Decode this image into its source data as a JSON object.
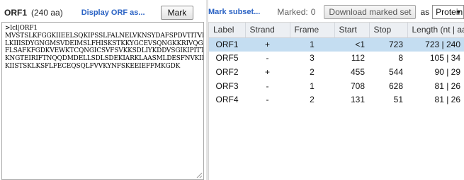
{
  "left_header": {
    "orf_title": "ORF1",
    "orf_length": "(240 aa)",
    "display_link": "Display ORF as...",
    "mark_button": "Mark"
  },
  "sequence": {
    "lines": [
      ">lcl|ORF1",
      "MVSTSLKFGGKIIEELSQKIPSSLFALNELVKNSYDAFSPDVTITVIPSE",
      "LKIIISDYGNGMSVDEIMSLFHISKSTKKYGCEVSQNGKKRIVQGSKGLG",
      "FLSAFKFGDKVEWKTCQNGICSVFSVKKSDLIYKDDVSGIKIPITTDSSN",
      "KNGTEIRIFTNQQDMDELLSDLSDEKIARKLAASMLDESFNVKIKIENKD",
      "KIISTSKLKSFLFECEQSQLFVVKYNFSKEEIEFFMKGDK"
    ]
  },
  "right_header": {
    "mark_subset_link": "Mark subset...",
    "marked_label": "Marked:",
    "marked_count": "0",
    "download_button": "Download marked set",
    "as_label": "as",
    "format_select": "Protein FASTA"
  },
  "table": {
    "columns": [
      "Label",
      "Strand",
      "Frame",
      "Start",
      "Stop",
      "Length (nt | aa)"
    ],
    "rows": [
      {
        "label": "ORF1",
        "strand": "+",
        "frame": "1",
        "start": "<1",
        "stop": "723",
        "length": "723 | 240",
        "selected": true
      },
      {
        "label": "ORF5",
        "strand": "-",
        "frame": "3",
        "start": "112",
        "stop": "8",
        "length": "105 | 34",
        "selected": false
      },
      {
        "label": "ORF2",
        "strand": "+",
        "frame": "2",
        "start": "455",
        "stop": "544",
        "length": "90 | 29",
        "selected": false
      },
      {
        "label": "ORF3",
        "strand": "-",
        "frame": "1",
        "start": "708",
        "stop": "628",
        "length": "81 | 26",
        "selected": false
      },
      {
        "label": "ORF4",
        "strand": "-",
        "frame": "2",
        "start": "131",
        "stop": "51",
        "length": "81 | 26",
        "selected": false
      }
    ]
  },
  "colors": {
    "link": "#2a62c4",
    "selected_row": "#c4ddf1",
    "header_bg": "#eceff3"
  }
}
